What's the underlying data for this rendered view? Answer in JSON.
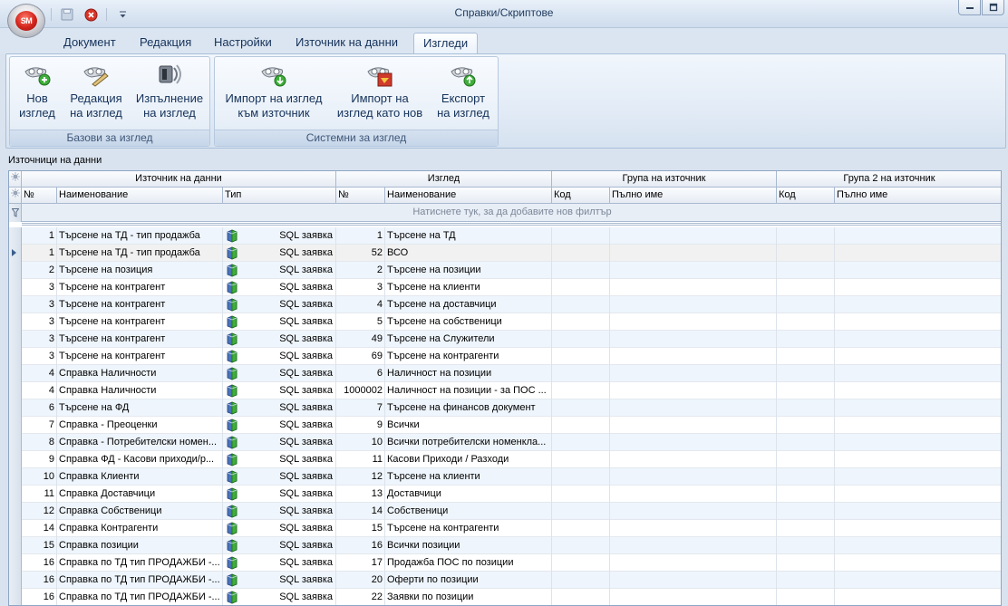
{
  "window": {
    "title": "Справки/Скриптове",
    "app_orb_text": "SM"
  },
  "tabs": [
    {
      "label": "Документ"
    },
    {
      "label": "Редакция"
    },
    {
      "label": "Настройки"
    },
    {
      "label": "Източник на данни"
    },
    {
      "label": "Изгледи",
      "active": true
    }
  ],
  "ribbon": {
    "groups": [
      {
        "label": "Базови за изглед",
        "buttons": [
          {
            "line1": "Нов",
            "line2": "изглед",
            "icon": "view-add-icon"
          },
          {
            "line1": "Редакция",
            "line2": "на изглед",
            "icon": "view-edit-icon"
          },
          {
            "line1": "Изпълнение",
            "line2": "на изглед",
            "icon": "view-run-icon"
          }
        ]
      },
      {
        "label": "Системни за изглед",
        "buttons": [
          {
            "line1": "Импорт на изглед",
            "line2": "към източник",
            "icon": "view-import-icon"
          },
          {
            "line1": "Импорт на",
            "line2": "изглед като нов",
            "icon": "view-import-new-icon"
          },
          {
            "line1": "Експорт",
            "line2": "на изглед",
            "icon": "view-export-icon"
          }
        ]
      }
    ]
  },
  "panel_title": "Източници на данни",
  "grid": {
    "band_headers": [
      "Източник на данни",
      "Изглед",
      "Група на източник",
      "Група 2 на източник"
    ],
    "columns": [
      "№",
      "Наименование",
      "Тип",
      "№",
      "Наименование",
      "Код",
      "Пълно име",
      "Код",
      "Пълно име"
    ],
    "filter_placeholder": "Натиснете тук, за да добавите нов филтър",
    "rows": [
      {
        "src_no": "1",
        "src_name": "Търсене на ТД - тип продажба",
        "type": "SQL заявка",
        "view_no": "1",
        "view_name": "Търсене на ТД"
      },
      {
        "src_no": "1",
        "src_name": "Търсене на ТД - тип продажба",
        "type": "SQL заявка",
        "view_no": "52",
        "view_name": "ВСО",
        "current": true
      },
      {
        "src_no": "2",
        "src_name": "Търсене на позиция",
        "type": "SQL заявка",
        "view_no": "2",
        "view_name": "Търсене на позиции"
      },
      {
        "src_no": "3",
        "src_name": "Търсене на контрагент",
        "type": "SQL заявка",
        "view_no": "3",
        "view_name": "Търсене на клиенти"
      },
      {
        "src_no": "3",
        "src_name": "Търсене на контрагент",
        "type": "SQL заявка",
        "view_no": "4",
        "view_name": "Търсене на доставчици"
      },
      {
        "src_no": "3",
        "src_name": "Търсене на контрагент",
        "type": "SQL заявка",
        "view_no": "5",
        "view_name": "Търсене на собственици"
      },
      {
        "src_no": "3",
        "src_name": "Търсене на контрагент",
        "type": "SQL заявка",
        "view_no": "49",
        "view_name": "Търсене на Служители"
      },
      {
        "src_no": "3",
        "src_name": "Търсене на контрагент",
        "type": "SQL заявка",
        "view_no": "69",
        "view_name": "Търсене на контрагенти"
      },
      {
        "src_no": "4",
        "src_name": "Справка Наличности",
        "type": "SQL заявка",
        "view_no": "6",
        "view_name": "Наличност на позиции"
      },
      {
        "src_no": "4",
        "src_name": "Справка Наличности",
        "type": "SQL заявка",
        "view_no": "1000002",
        "view_name": "Наличност на позиции - за ПОС ..."
      },
      {
        "src_no": "6",
        "src_name": "Търсене на ФД",
        "type": "SQL заявка",
        "view_no": "7",
        "view_name": "Търсене на финансов документ"
      },
      {
        "src_no": "7",
        "src_name": "Справка - Преоценки",
        "type": "SQL заявка",
        "view_no": "9",
        "view_name": "Всички"
      },
      {
        "src_no": "8",
        "src_name": "Справка - Потребителски номен...",
        "type": "SQL заявка",
        "view_no": "10",
        "view_name": "Всички потребителски номенкла..."
      },
      {
        "src_no": "9",
        "src_name": "Справка ФД - Касови приходи/р...",
        "type": "SQL заявка",
        "view_no": "11",
        "view_name": "Касови Приходи / Разходи"
      },
      {
        "src_no": "10",
        "src_name": "Справка Клиенти",
        "type": "SQL заявка",
        "view_no": "12",
        "view_name": "Търсене на клиенти"
      },
      {
        "src_no": "11",
        "src_name": "Справка Доставчици",
        "type": "SQL заявка",
        "view_no": "13",
        "view_name": "Доставчици"
      },
      {
        "src_no": "12",
        "src_name": "Справка Собственици",
        "type": "SQL заявка",
        "view_no": "14",
        "view_name": "Собственици"
      },
      {
        "src_no": "14",
        "src_name": "Справка Контрагенти",
        "type": "SQL заявка",
        "view_no": "15",
        "view_name": "Търсене на контрагенти"
      },
      {
        "src_no": "15",
        "src_name": "Справка позиции",
        "type": "SQL заявка",
        "view_no": "16",
        "view_name": "Всички позиции"
      },
      {
        "src_no": "16",
        "src_name": "Справка по ТД тип ПРОДАЖБИ -...",
        "type": "SQL заявка",
        "view_no": "17",
        "view_name": "Продажба ПОС по позиции"
      },
      {
        "src_no": "16",
        "src_name": "Справка по ТД тип ПРОДАЖБИ -...",
        "type": "SQL заявка",
        "view_no": "20",
        "view_name": "Оферти по позиции"
      },
      {
        "src_no": "16",
        "src_name": "Справка по ТД тип ПРОДАЖБИ -...",
        "type": "SQL заявка",
        "view_no": "22",
        "view_name": "Заявки по позиции"
      }
    ]
  }
}
